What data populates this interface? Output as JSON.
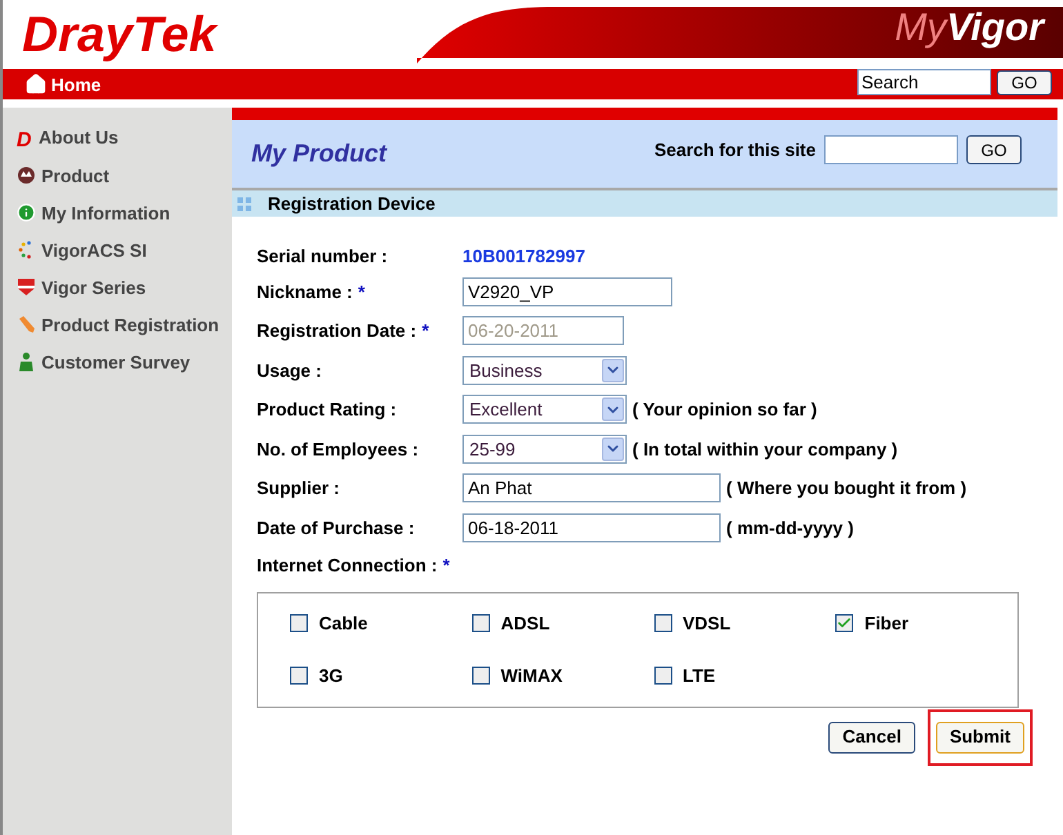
{
  "header": {
    "logo": "DrayTek",
    "brand_prefix": "My",
    "brand_main": "Vigor",
    "home": "Home",
    "search": {
      "value": "Search"
    },
    "go": "GO"
  },
  "sidebar": {
    "items": [
      {
        "label": "About Us",
        "icon_text": "D"
      },
      {
        "label": "Product"
      },
      {
        "label": "My Information"
      },
      {
        "label": "VigorACS SI"
      },
      {
        "label": "Vigor Series"
      },
      {
        "label": "Product Registration"
      },
      {
        "label": "Customer Survey"
      }
    ]
  },
  "page": {
    "title": "My Product",
    "search_label": "Search for this site",
    "go": "GO",
    "section": "Registration Device"
  },
  "form": {
    "rows": [
      {
        "label": "Serial number :",
        "kind": "static",
        "value": "10B001782997"
      },
      {
        "label": "Nickname :",
        "kind": "text",
        "value": "V2920_VP",
        "required_mark": "*",
        "disabled": false
      },
      {
        "label": "Registration Date :",
        "kind": "date",
        "value": "06-20-2011",
        "required_mark": "*",
        "disabled": true
      },
      {
        "label": "Usage :",
        "kind": "select",
        "value": "Business"
      },
      {
        "label": "Product Rating :",
        "kind": "select",
        "value": "Excellent",
        "hint": "( Your opinion so far )"
      },
      {
        "label": "No. of Employees :",
        "kind": "select",
        "value": "25-99",
        "hint": "( In total within your company )"
      },
      {
        "label": "Supplier :",
        "kind": "long_text",
        "value": "An Phat",
        "disabled": false,
        "hint": "( Where you bought it from )"
      },
      {
        "label": "Date of Purchase :",
        "kind": "long_text",
        "value": "06-18-2011",
        "disabled": false,
        "hint": "( mm-dd-yyyy )"
      }
    ],
    "connection": {
      "label": "Internet Connection :",
      "required_mark": "*",
      "options": [
        {
          "label": "Cable",
          "checked": false
        },
        {
          "label": "ADSL",
          "checked": false
        },
        {
          "label": "VDSL",
          "checked": false
        },
        {
          "label": "Fiber",
          "checked": true
        },
        {
          "label": "3G",
          "checked": false
        },
        {
          "label": "WiMAX",
          "checked": false
        },
        {
          "label": "LTE",
          "checked": false
        }
      ]
    },
    "buttons": [
      {
        "label": "Cancel",
        "highlighted": false
      },
      {
        "label": "Submit",
        "highlighted": true
      }
    ]
  }
}
